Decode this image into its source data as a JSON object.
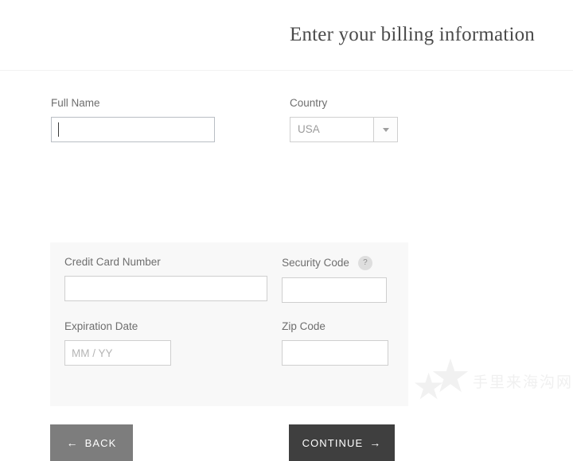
{
  "header": {
    "title": "Enter your billing information"
  },
  "form": {
    "full_name": {
      "label": "Full Name",
      "value": "",
      "placeholder": ""
    },
    "country": {
      "label": "Country",
      "value": "USA",
      "options": [
        "USA"
      ]
    },
    "credit_card_number": {
      "label": "Credit Card Number",
      "value": "",
      "placeholder": ""
    },
    "security_code": {
      "label": "Security Code",
      "value": "",
      "placeholder": "",
      "help_icon": "question-mark-icon",
      "help_glyph": "?"
    },
    "expiration_date": {
      "label": "Expiration Date",
      "value": "",
      "placeholder": "MM / YY"
    },
    "zip_code": {
      "label": "Zip Code",
      "value": "",
      "placeholder": ""
    }
  },
  "buttons": {
    "back": {
      "label": "BACK",
      "arrow": "←",
      "color": "#7d7d7d"
    },
    "continue": {
      "label": "CONTINUE",
      "arrow": "→",
      "color": "#3f3f3f"
    }
  },
  "watermark": {
    "text": "手里来海沟网",
    "star_glyph": "★",
    "color": "#f0f0f0"
  },
  "colors": {
    "panel_background": "#f8f8f8",
    "input_border": "#cfcfcf",
    "focused_input_border": "#b9bec4",
    "label_text": "#6e6e6e",
    "title_text": "#4a4a4a",
    "placeholder_text": "#b5b5b5"
  }
}
